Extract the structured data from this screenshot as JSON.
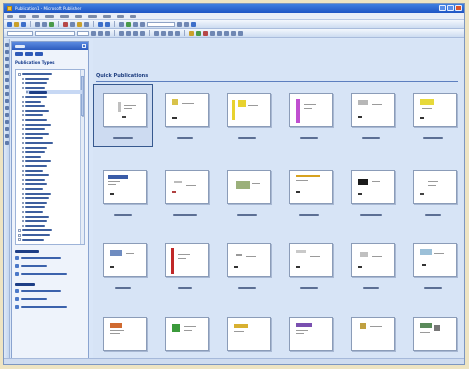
{
  "window": {
    "title": "Publication1 - Microsoft Publisher",
    "app_icon": "publisher-icon",
    "controls": [
      "minimize-icon",
      "maximize-icon",
      "close-icon"
    ]
  },
  "menubar": {
    "items": [
      "",
      "",
      "",
      "",
      "",
      "",
      "",
      "",
      "",
      ""
    ]
  },
  "taskpane": {
    "header": "",
    "section_title": "Publication Types",
    "tree": [
      {
        "label": "",
        "level": 0,
        "expandable": true
      },
      {
        "label": "",
        "level": 1
      },
      {
        "label": "",
        "level": 1
      },
      {
        "label": "",
        "level": 1
      },
      {
        "label": "",
        "level": 2,
        "selected": true
      },
      {
        "label": "",
        "level": 1
      },
      {
        "label": "",
        "level": 1
      },
      {
        "label": "",
        "level": 1
      },
      {
        "label": "",
        "level": 1
      },
      {
        "label": "",
        "level": 1
      },
      {
        "label": "",
        "level": 1
      },
      {
        "label": "",
        "level": 1
      },
      {
        "label": "",
        "level": 1
      },
      {
        "label": "",
        "level": 1
      },
      {
        "label": "",
        "level": 1
      },
      {
        "label": "",
        "level": 1
      },
      {
        "label": "",
        "level": 1
      },
      {
        "label": "",
        "level": 1
      },
      {
        "label": "",
        "level": 1
      },
      {
        "label": "",
        "level": 1
      },
      {
        "label": "",
        "level": 1
      },
      {
        "label": "",
        "level": 1
      },
      {
        "label": "",
        "level": 1
      },
      {
        "label": "",
        "level": 1
      },
      {
        "label": "",
        "level": 1
      },
      {
        "label": "",
        "level": 1
      },
      {
        "label": "",
        "level": 1
      },
      {
        "label": "",
        "level": 1
      },
      {
        "label": "",
        "level": 1
      },
      {
        "label": "",
        "level": 1
      },
      {
        "label": "",
        "level": 1
      },
      {
        "label": "",
        "level": 1
      },
      {
        "label": "",
        "level": 1
      },
      {
        "label": "",
        "level": 1
      },
      {
        "label": "",
        "level": 0,
        "expandable": true
      },
      {
        "label": "",
        "level": 0,
        "expandable": true
      },
      {
        "label": "",
        "level": 0,
        "expandable": true
      }
    ],
    "open_group": {
      "title": "",
      "links": [
        "",
        "",
        ""
      ]
    },
    "other_group": {
      "title": "",
      "links": [
        "",
        "",
        ""
      ]
    }
  },
  "gallery": {
    "title": "Quick Publications",
    "thumbnails": [
      {
        "caption": "",
        "accent": "#bfbfbf",
        "selected": true
      },
      {
        "caption": "",
        "accent": "#d8c24a"
      },
      {
        "caption": "",
        "accent": "#e8d22f"
      },
      {
        "caption": "",
        "accent": "#c04fd0"
      },
      {
        "caption": "",
        "accent": "#b7b7b7"
      },
      {
        "caption": "",
        "accent": "#e7d93a"
      },
      {
        "caption": "",
        "accent": "#3a5ca8"
      },
      {
        "caption": "",
        "accent": "#b04040"
      },
      {
        "caption": "",
        "accent": "#9bb07a"
      },
      {
        "caption": "",
        "accent": "#d7a21f"
      },
      {
        "caption": "",
        "accent": "#1a1a1a"
      },
      {
        "caption": "",
        "accent": "#c8c8c8"
      },
      {
        "caption": "",
        "accent": "#6f8cc0"
      },
      {
        "caption": "",
        "accent": "#c02828"
      },
      {
        "caption": "",
        "accent": "#b9b9b9"
      },
      {
        "caption": "",
        "accent": "#c9c9c9"
      },
      {
        "caption": "",
        "accent": "#c0c0c0"
      },
      {
        "caption": "",
        "accent": "#9cc0d8"
      },
      {
        "caption": "",
        "accent": "#d06a30"
      },
      {
        "caption": "",
        "accent": "#3b9a3b"
      },
      {
        "caption": "",
        "accent": "#d8b030"
      },
      {
        "caption": "",
        "accent": "#7a50b0"
      },
      {
        "caption": "",
        "accent": "#c0a040"
      },
      {
        "caption": "",
        "accent": "#5a8a5a"
      }
    ]
  }
}
